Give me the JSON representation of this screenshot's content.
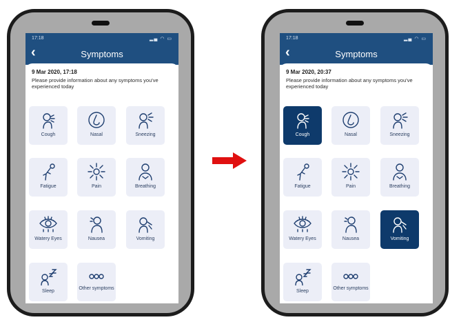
{
  "colors": {
    "header": "#1f4f80",
    "tile": "#eceef7",
    "tile_selected": "#0e3a6b",
    "arrow": "#e01010"
  },
  "before": {
    "status_time": "17:18",
    "screen_title": "Symptoms",
    "date": "9 Mar 2020, 17:18",
    "prompt": "Please provide information about any symptoms you've experienced today",
    "symptoms": [
      {
        "label": "Cough",
        "icon": "cough-icon",
        "selected": false
      },
      {
        "label": "Nasal",
        "icon": "nose-icon",
        "selected": false
      },
      {
        "label": "Sneezing",
        "icon": "sneezing-icon",
        "selected": false
      },
      {
        "label": "Fatigue",
        "icon": "fatigue-icon",
        "selected": false
      },
      {
        "label": "Pain",
        "icon": "pain-icon",
        "selected": false
      },
      {
        "label": "Breathing",
        "icon": "breathing-icon",
        "selected": false
      },
      {
        "label": "Watery Eyes",
        "icon": "eye-icon",
        "selected": false
      },
      {
        "label": "Nausea",
        "icon": "nausea-icon",
        "selected": false
      },
      {
        "label": "Vomiting",
        "icon": "vomiting-icon",
        "selected": false
      },
      {
        "label": "Sleep",
        "icon": "sleep-icon",
        "selected": false
      },
      {
        "label": "Other symptoms",
        "icon": "more-icon",
        "selected": false
      }
    ]
  },
  "after": {
    "status_time": "17:18",
    "screen_title": "Symptoms",
    "date": "9 Mar 2020, 20:37",
    "prompt": "Please provide information about any symptoms you've experienced today",
    "symptoms": [
      {
        "label": "Cough",
        "icon": "cough-icon",
        "selected": true
      },
      {
        "label": "Nasal",
        "icon": "nose-icon",
        "selected": false
      },
      {
        "label": "Sneezing",
        "icon": "sneezing-icon",
        "selected": false
      },
      {
        "label": "Fatigue",
        "icon": "fatigue-icon",
        "selected": false
      },
      {
        "label": "Pain",
        "icon": "pain-icon",
        "selected": false
      },
      {
        "label": "Breathing",
        "icon": "breathing-icon",
        "selected": false
      },
      {
        "label": "Watery Eyes",
        "icon": "eye-icon",
        "selected": false
      },
      {
        "label": "Nausea",
        "icon": "nausea-icon",
        "selected": false
      },
      {
        "label": "Vomiting",
        "icon": "vomiting-icon",
        "selected": true
      },
      {
        "label": "Sleep",
        "icon": "sleep-icon",
        "selected": false
      },
      {
        "label": "Other symptoms",
        "icon": "more-icon",
        "selected": false
      }
    ]
  }
}
